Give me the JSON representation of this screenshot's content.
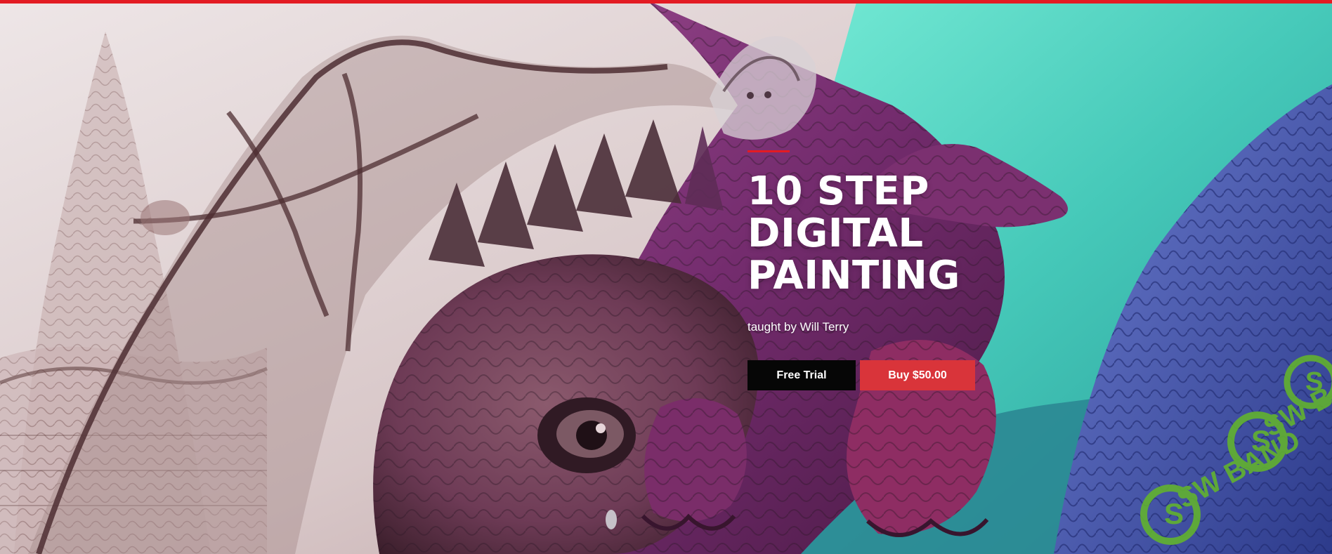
{
  "hero": {
    "title_lines": [
      "10 STEP",
      "DIGITAL",
      "PAINTING"
    ],
    "instructor_text": "taught by Will Terry"
  },
  "actions": {
    "free_trial_label": "Free Trial",
    "buy_label": "Buy $50.00"
  },
  "colors": {
    "accent_red": "#e31b23",
    "buy_button": "#d9343a",
    "free_button": "#060606",
    "sky_teal": "#55d4c1",
    "dragon_purple": "#7a2c6b",
    "sketch_brown": "#6f4e4e"
  },
  "watermark": {
    "logo_text": "SW BAND",
    "brand_color": "#62b22f"
  }
}
